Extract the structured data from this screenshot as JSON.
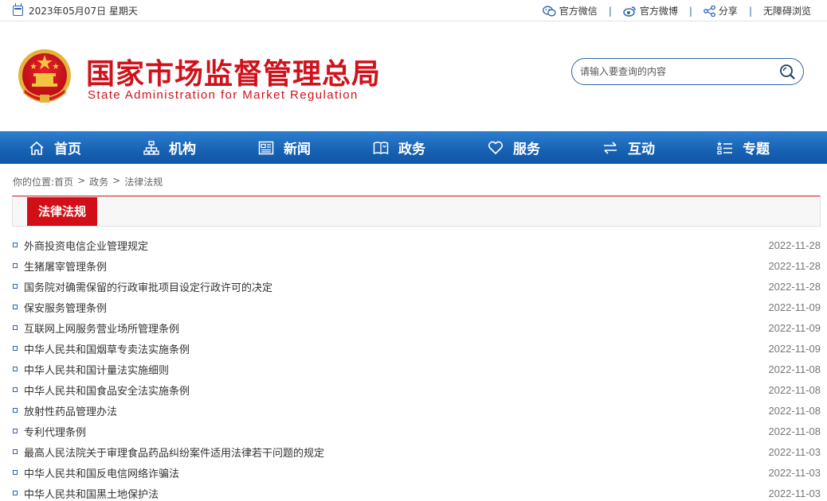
{
  "topbar": {
    "date": "2023年05月07日 星期天",
    "wechat": "官方微信",
    "weibo": "官方微博",
    "share": "分享",
    "accessible": "无障碍浏览",
    "sep": "|"
  },
  "header": {
    "title_cn": "国家市场监督管理总局",
    "title_en": "State Administration for Market Regulation",
    "search_placeholder": "请输入要查询的内容"
  },
  "nav": {
    "items": [
      {
        "label": "首页",
        "icon": "home-icon"
      },
      {
        "label": "机构",
        "icon": "org-chart-icon"
      },
      {
        "label": "新闻",
        "icon": "news-icon"
      },
      {
        "label": "政务",
        "icon": "book-icon"
      },
      {
        "label": "服务",
        "icon": "heart-icon"
      },
      {
        "label": "互动",
        "icon": "exchange-icon"
      },
      {
        "label": "专题",
        "icon": "topic-list-icon"
      }
    ]
  },
  "breadcrumb": {
    "prefix": "你的位置:",
    "items": [
      "首页",
      "政务",
      "法律法规"
    ],
    "sep": ">"
  },
  "section": {
    "title": "法律法规"
  },
  "articles": [
    {
      "title": "外商投资电信企业管理规定",
      "date": "2022-11-28"
    },
    {
      "title": "生猪屠宰管理条例",
      "date": "2022-11-28"
    },
    {
      "title": "国务院对确需保留的行政审批项目设定行政许可的决定",
      "date": "2022-11-28"
    },
    {
      "title": "保安服务管理条例",
      "date": "2022-11-09"
    },
    {
      "title": "互联网上网服务营业场所管理条例",
      "date": "2022-11-09"
    },
    {
      "title": "中华人民共和国烟草专卖法实施条例",
      "date": "2022-11-09"
    },
    {
      "title": "中华人民共和国计量法实施细则",
      "date": "2022-11-08"
    },
    {
      "title": "中华人民共和国食品安全法实施条例",
      "date": "2022-11-08"
    },
    {
      "title": "放射性药品管理办法",
      "date": "2022-11-08"
    },
    {
      "title": "专利代理条例",
      "date": "2022-11-08"
    },
    {
      "title": "最高人民法院关于审理食品药品纠纷案件适用法律若干问题的规定",
      "date": "2022-11-03"
    },
    {
      "title": "中华人民共和国反电信网络诈骗法",
      "date": "2022-11-03"
    },
    {
      "title": "中华人民共和国黑土地保护法",
      "date": "2022-11-03"
    }
  ],
  "colors": {
    "brand_red": "#d0121b",
    "brand_blue": "#1863b4"
  }
}
